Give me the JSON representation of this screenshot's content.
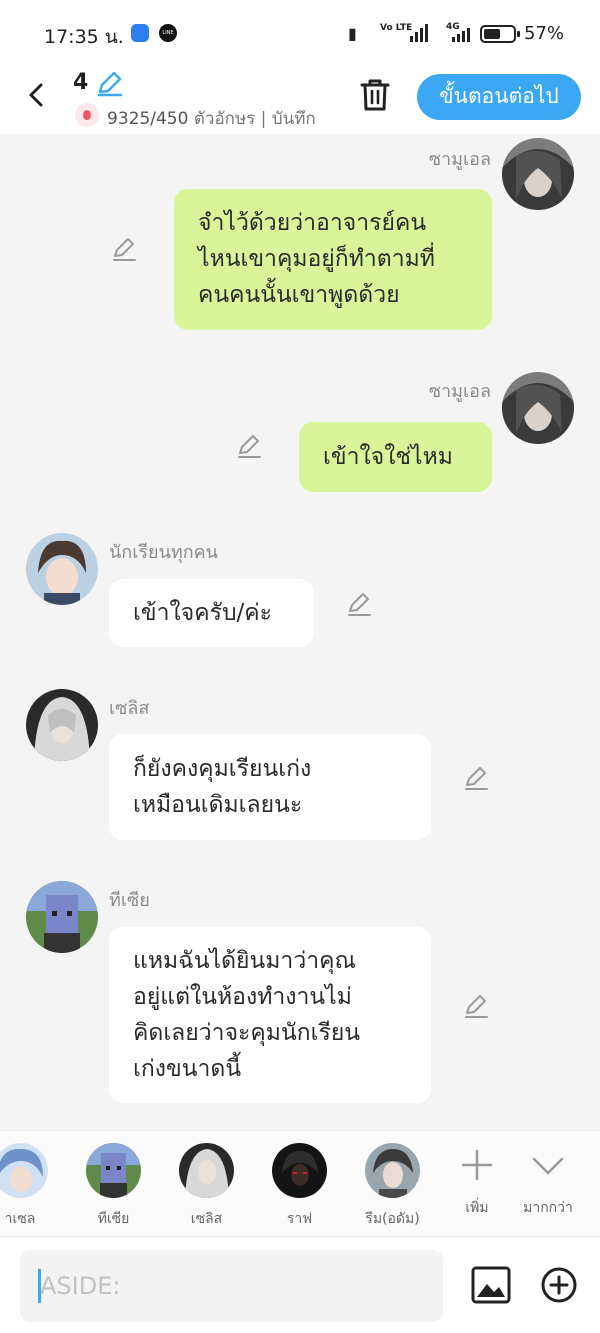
{
  "status_bar": {
    "time": "17:35 น.",
    "volte": "Vo LTE",
    "network": "4G",
    "battery_level": 0.57,
    "battery_text": "57%"
  },
  "header": {
    "episode_number": "4",
    "character_count": "9325/450",
    "count_suffix": " ตัวอักษร | บันทึก",
    "next_button": "ขั้นตอนต่อไป",
    "icons": [
      "back-arrow-icon",
      "pencil-icon",
      "fire-icon",
      "trash-icon"
    ]
  },
  "messages": [
    {
      "sender": "ซามูเอล",
      "side": "right",
      "lines": [
        "จำไว้ด้วยว่าอาจารย์คน",
        "ไหนเขาคุมอยู่ก็ทำตามที่",
        "คนคนนั้นเขาพูดด้วย"
      ]
    },
    {
      "sender": "ซามูเอล",
      "side": "right",
      "lines": [
        "เข้าใจใช่ไหม"
      ]
    },
    {
      "sender": "นักเรียนทุกคน",
      "side": "left",
      "lines": [
        "เข้าใจครับ/ค่ะ"
      ]
    },
    {
      "sender": "เซลิส",
      "side": "left",
      "lines": [
        "ก็ยังคงคุมเรียนเก่ง",
        "เหมือนเดิมเลยนะ"
      ]
    },
    {
      "sender": "ทีเซีย",
      "side": "left",
      "lines": [
        "แหมฉันได้ยินมาว่าคุณ",
        "อยู่แต่ในห้องทำงานไม่",
        "คิดเลยว่าจะคุมนักเรียน",
        "เก่งขนาดนี้"
      ]
    }
  ],
  "characters": [
    {
      "label": "าเซล"
    },
    {
      "label": "ทีเซีย"
    },
    {
      "label": "เซลิส"
    },
    {
      "label": "ราฟ"
    },
    {
      "label": "รีม(อดัม)"
    }
  ],
  "char_actions": {
    "add": "เพิ่ม",
    "more": "มากกว่า"
  },
  "input": {
    "placeholder": "ASIDE:"
  },
  "colors": {
    "accent": "#3ca7f5",
    "my_bubble": "#d8f59a",
    "their_bubble": "#ffffff",
    "background": "#f4f4f4"
  }
}
